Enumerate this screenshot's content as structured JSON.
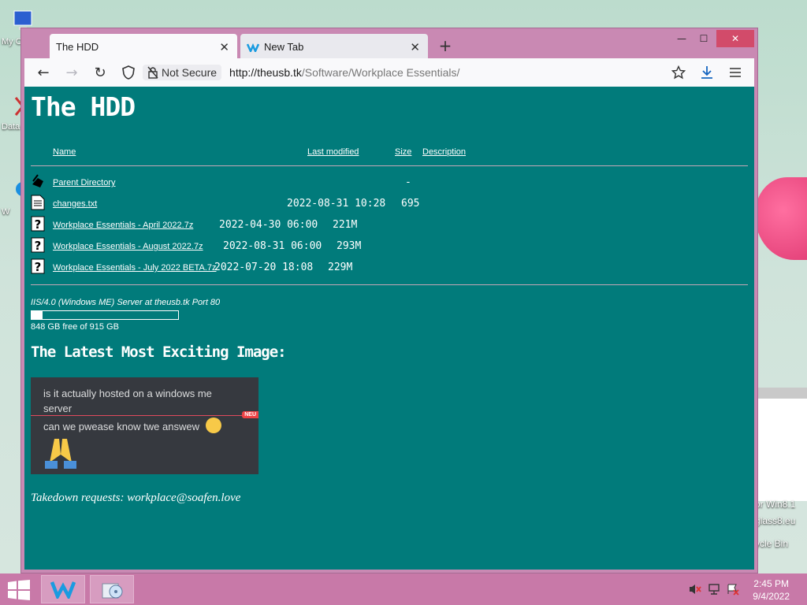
{
  "desktop": {
    "icons": [
      {
        "label": "My C"
      },
      {
        "label": "Data"
      },
      {
        "label": "W"
      }
    ],
    "right_text": [
      "or Win8.1",
      "glass8.eu",
      "ycle Bin"
    ]
  },
  "browser": {
    "tabs": [
      {
        "title": "The HDD",
        "close": "✕"
      },
      {
        "title": "New Tab",
        "close": "✕"
      }
    ],
    "new_tab": "+",
    "window_controls": {
      "minimize": "—",
      "maximize": "☐",
      "close": "✕"
    },
    "nav": {
      "back": "←",
      "forward": "→",
      "reload": "↻"
    },
    "security_label": "Not Secure",
    "url_domain": "http://theusb.tk",
    "url_path": "/Software/Workplace Essentials/"
  },
  "page": {
    "title": "The HDD",
    "columns": {
      "name": "Name",
      "last_modified": "Last modified",
      "size": "Size",
      "description": "Description"
    },
    "rows": [
      {
        "name": "Parent Directory",
        "date": "",
        "size": "-",
        "icon": "back-icon"
      },
      {
        "name": "changes.txt",
        "date": "2022-08-31 10:28",
        "size": "695",
        "icon": "text-file-icon"
      },
      {
        "name": "Workplace Essentials - April 2022.7z",
        "date": "2022-04-30 06:00",
        "size": "221M",
        "icon": "unknown-file-icon"
      },
      {
        "name": "Workplace Essentials - August 2022.7z",
        "date": "2022-08-31 06:00",
        "size": "293M",
        "icon": "unknown-file-icon"
      },
      {
        "name": "Workplace Essentials - July 2022 BETA.7z",
        "date": "2022-07-20 18:08",
        "size": "229M",
        "icon": "unknown-file-icon"
      }
    ],
    "server_info": "IIS/4.0 (Windows ME) Server at theusb.tk Port 80",
    "disk_used_fraction": 0.073,
    "disk_free": "848 GB free of 915 GB",
    "image_heading": "The Latest Most Exciting Image:",
    "image": {
      "line1": "is it actually hosted on a windows me server",
      "new_badge": "NEU",
      "line2": "can we pwease know twe answew"
    },
    "takedown": "Takedown requests: workplace@soafen.love"
  },
  "taskbar": {
    "time": "2:45 PM",
    "date": "9/4/2022"
  },
  "colors": {
    "page_bg": "#017b7b",
    "window_frame": "#c989b3",
    "taskbar": "#c879a8"
  }
}
